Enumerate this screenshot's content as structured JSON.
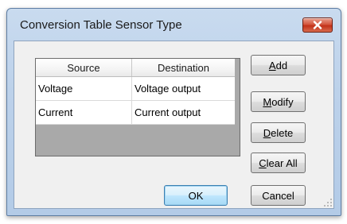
{
  "window": {
    "title": "Conversion Table Sensor Type"
  },
  "table": {
    "columns": [
      "Source",
      "Destination"
    ],
    "rows": [
      [
        "Voltage",
        "Voltage output"
      ],
      [
        "Current",
        "Current output"
      ]
    ]
  },
  "buttons": {
    "add": {
      "accel": "A",
      "rest": "dd"
    },
    "modify": {
      "accel": "M",
      "rest": "odify"
    },
    "delete": {
      "accel": "D",
      "rest": "elete"
    },
    "clear_all": {
      "accel": "C",
      "rest": "lear All"
    },
    "ok": "OK",
    "cancel": "Cancel"
  },
  "icons": {
    "close": "close-icon",
    "resize_grip": "resize-grip-icon"
  },
  "colors": {
    "title_bar": "#bcd1ea",
    "close_button": "#c9442c",
    "dialog_bg": "#f0f0f0",
    "table_bg": "#a9a9a9",
    "default_button_border": "#3c7fb1"
  }
}
